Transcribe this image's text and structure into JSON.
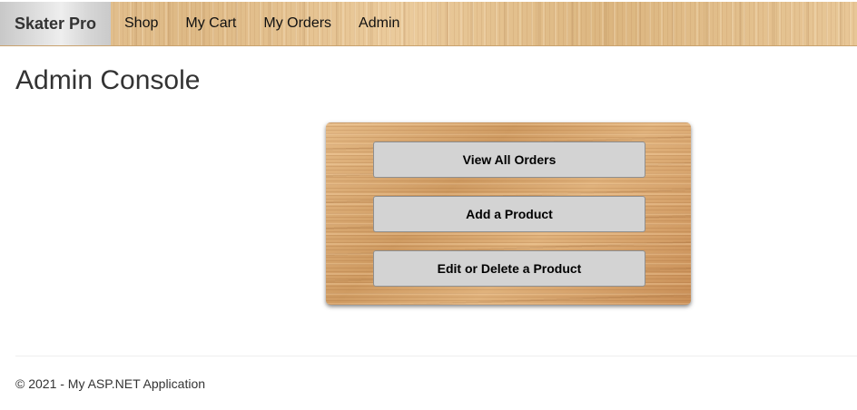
{
  "navbar": {
    "brand": "Skater Pro",
    "items": [
      {
        "label": "Shop"
      },
      {
        "label": "My Cart"
      },
      {
        "label": "My Orders"
      },
      {
        "label": "Admin"
      }
    ]
  },
  "page": {
    "title": "Admin Console"
  },
  "admin_panel": {
    "buttons": [
      {
        "label": "View All Orders"
      },
      {
        "label": "Add a Product"
      },
      {
        "label": "Edit or Delete a Product"
      }
    ]
  },
  "footer": {
    "text": "© 2021 - My ASP.NET Application"
  },
  "colors": {
    "brand_background": "#dcdcdc",
    "button_background": "#d3d3d3",
    "wood_light": "#e6c596",
    "wood_dark": "#cf9b62"
  }
}
